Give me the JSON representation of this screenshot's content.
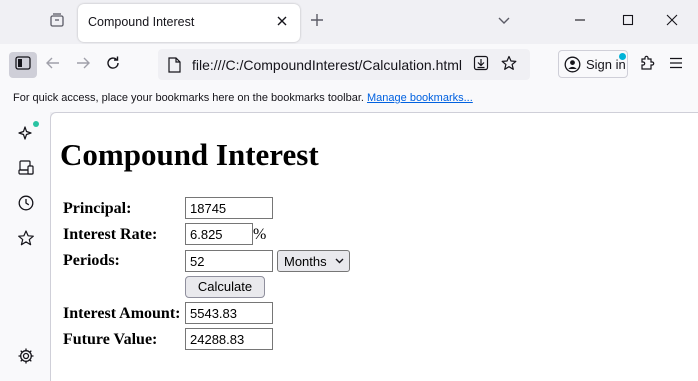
{
  "browser": {
    "tab": {
      "title": "Compound Interest"
    },
    "url": "file:///C:/CompoundInterest/Calculation.html",
    "signin_label": "Sign in",
    "bookmarks_message": "For quick access, place your bookmarks here on the bookmarks toolbar.",
    "bookmarks_link": "Manage bookmarks...",
    "sidebar_icons": [
      "ai-chatbot-icon",
      "synced-tabs-icon",
      "history-icon",
      "bookmarks-star-icon",
      "settings-gear-icon"
    ],
    "colors": {
      "accent_dot": "#00b3d8",
      "sidebar_dot": "#2ac3a2",
      "link": "#0061e0"
    }
  },
  "page": {
    "title": "Compound Interest",
    "principal_label": "Principal:",
    "principal_value": "18745",
    "rate_label": "Interest Rate:",
    "rate_value": "6.825",
    "rate_unit": "%",
    "periods_label": "Periods:",
    "periods_value": "52",
    "periods_unit_selected": "Months",
    "calculate_label": "Calculate",
    "interest_amount_label": "Interest Amount:",
    "interest_amount_value": "5543.83",
    "future_value_label": "Future Value:",
    "future_value_value": "24288.83"
  }
}
